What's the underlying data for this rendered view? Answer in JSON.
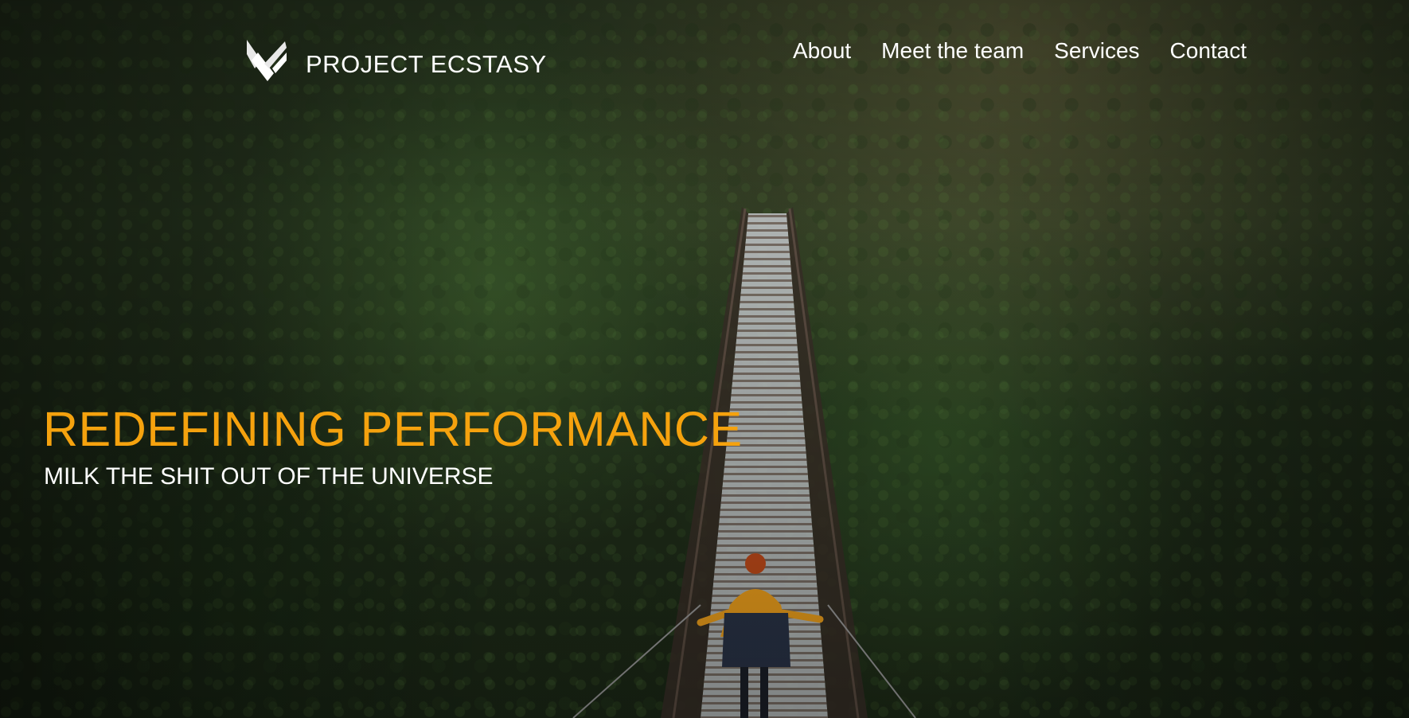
{
  "header": {
    "brand": "PROJECT ECSTASY",
    "logo_icon": "chevron-wings-logo-icon",
    "nav": [
      {
        "label": "About"
      },
      {
        "label": "Meet the team"
      },
      {
        "label": "Services"
      },
      {
        "label": "Contact"
      }
    ]
  },
  "hero": {
    "headline": "REDEFINING PERFORMANCE",
    "subheadline": "MILK THE SHIT OUT OF THE UNIVERSE",
    "background_image": "forest-suspension-bridge-photo"
  },
  "colors": {
    "accent": "#f5a20e",
    "text": "#ffffff",
    "forest": "#24331d"
  }
}
